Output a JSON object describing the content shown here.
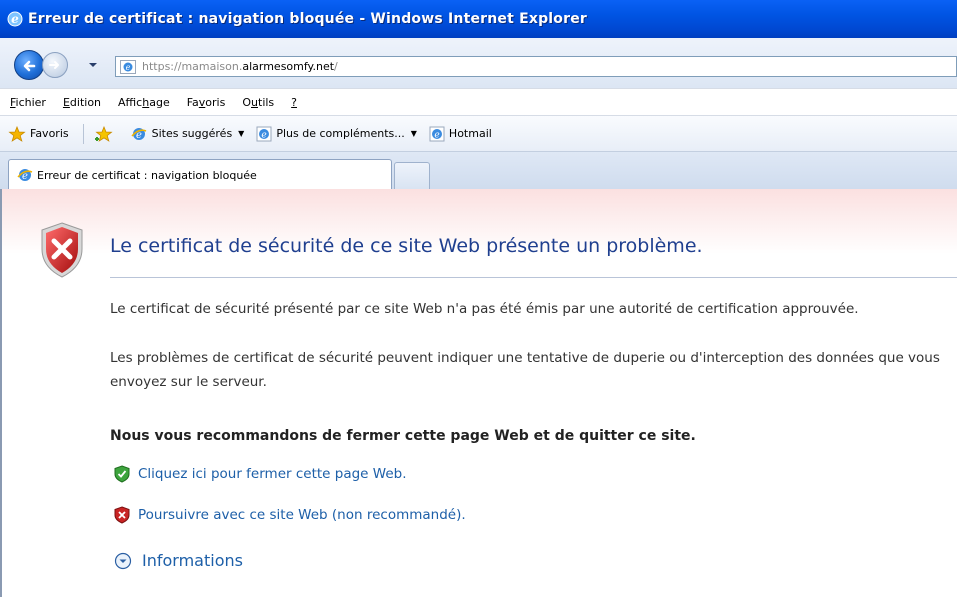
{
  "window": {
    "title": "Erreur de certificat : navigation bloquée - Windows Internet Explorer"
  },
  "address": {
    "proto": "https://",
    "sub": "mamaison.",
    "host": "alarmesomfy.net",
    "path": "/"
  },
  "menu": [
    "Fichier",
    "Edition",
    "Affichage",
    "Favoris",
    "Outils",
    "?"
  ],
  "favorites": {
    "favoris": "Favoris",
    "sites": "Sites suggérés",
    "plus": "Plus de compléments...",
    "hotmail": "Hotmail"
  },
  "tab": {
    "label": "Erreur de certificat : navigation bloquée"
  },
  "page": {
    "heading": "Le certificat de sécurité de ce site Web présente un problème.",
    "p1": "Le certificat de sécurité présenté par ce site Web n'a pas été émis par une autorité de certification approuvée.",
    "p2": "Les problèmes de certificat de sécurité peuvent indiquer une tentative de duperie ou d'interception des données que vous envoyez sur le serveur.",
    "recommend": "Nous vous recommandons de fermer cette page Web et de quitter ce site.",
    "close_link": "Cliquez ici pour fermer cette page Web.",
    "continue_link": "Poursuivre avec ce site Web (non recommandé).",
    "info": "Informations"
  }
}
